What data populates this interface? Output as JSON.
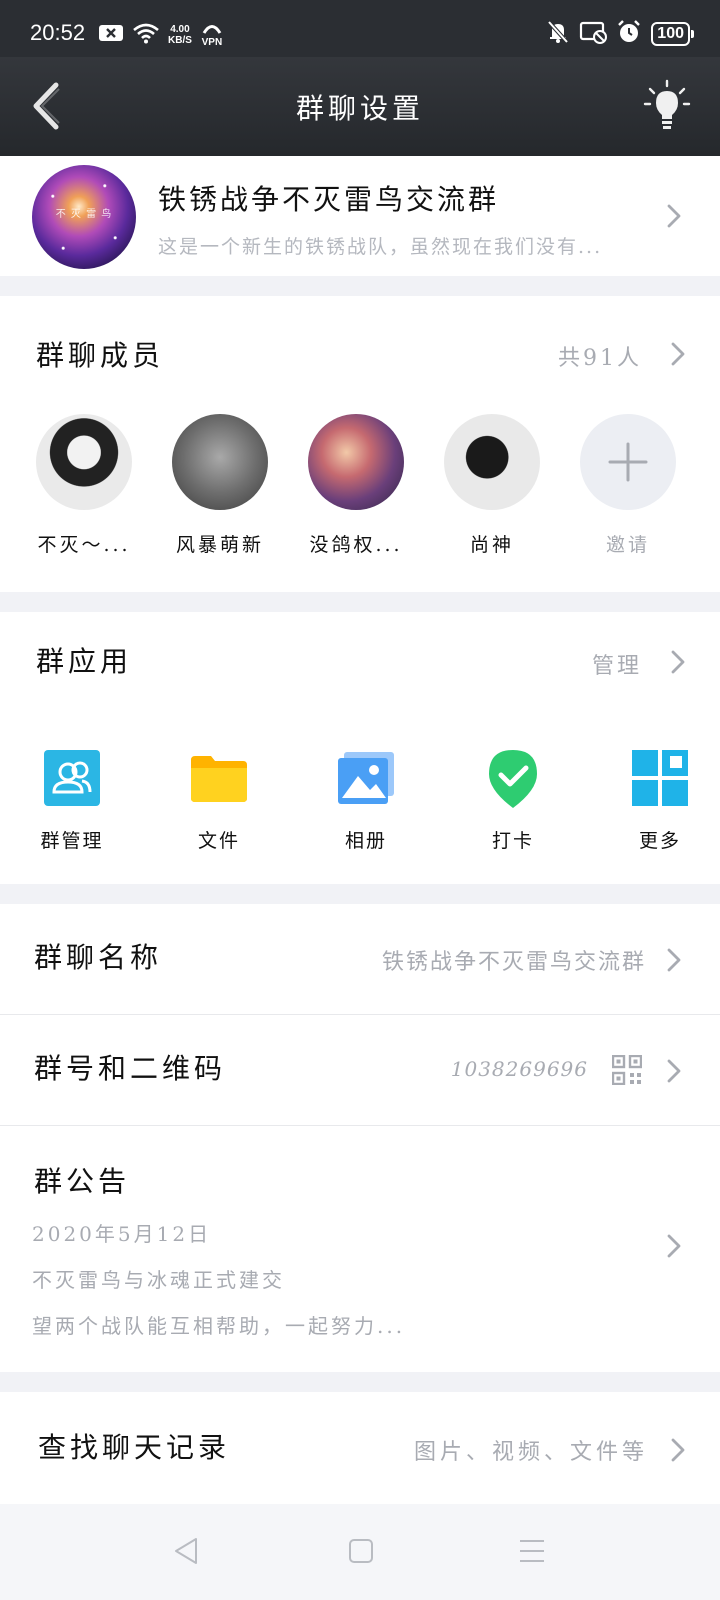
{
  "status_bar": {
    "time": "20:52",
    "net_speed_value": "4.00",
    "net_speed_unit": "KB/S",
    "vpn_label": "VPN",
    "battery": "100"
  },
  "nav": {
    "title": "群聊设置",
    "icons": [
      "back-arrow-icon",
      "lightbulb-icon"
    ]
  },
  "group": {
    "avatar_text": "不 灭 雷 鸟",
    "name": "铁锈战争不灭雷鸟交流群",
    "description": "这是一个新生的铁锈战队，虽然现在我们没有..."
  },
  "members": {
    "title": "群聊成员",
    "count_label": "共91人",
    "list": [
      {
        "name": "不灭～..."
      },
      {
        "name": "风暴萌新"
      },
      {
        "name": "没鸽权..."
      },
      {
        "name": "尚神"
      }
    ],
    "invite_label": "邀请"
  },
  "apps": {
    "title": "群应用",
    "manage_label": "管理",
    "items": [
      {
        "label": "群管理",
        "icon": "group-manage-icon",
        "color": "#2bb6e4"
      },
      {
        "label": "文件",
        "icon": "folder-icon",
        "color": "#ffc61a"
      },
      {
        "label": "相册",
        "icon": "photo-album-icon",
        "color": "#4a9ff5"
      },
      {
        "label": "打卡",
        "icon": "check-in-icon",
        "color": "#2ecc71"
      },
      {
        "label": "更多",
        "icon": "more-grid-icon",
        "color": "#1fb3e8"
      }
    ]
  },
  "settings": {
    "group_name": {
      "label": "群聊名称",
      "value": "铁锈战争不灭雷鸟交流群"
    },
    "group_number": {
      "label": "群号和二维码",
      "value": "1038269696"
    },
    "announcement": {
      "label": "群公告",
      "date": "2020年5月12日",
      "line1": "不灭雷鸟与冰魂正式建交",
      "line2": "望两个战队能互相帮助，一起努力..."
    }
  },
  "search": {
    "label": "查找聊天记录",
    "hint": "图片、视频、文件等"
  },
  "colors": {
    "status_bar_bg": "#2b2e33",
    "nav_bg": "#2f3237",
    "page_bg": "#f1f2f6",
    "secondary_text": "#a8abb2"
  }
}
